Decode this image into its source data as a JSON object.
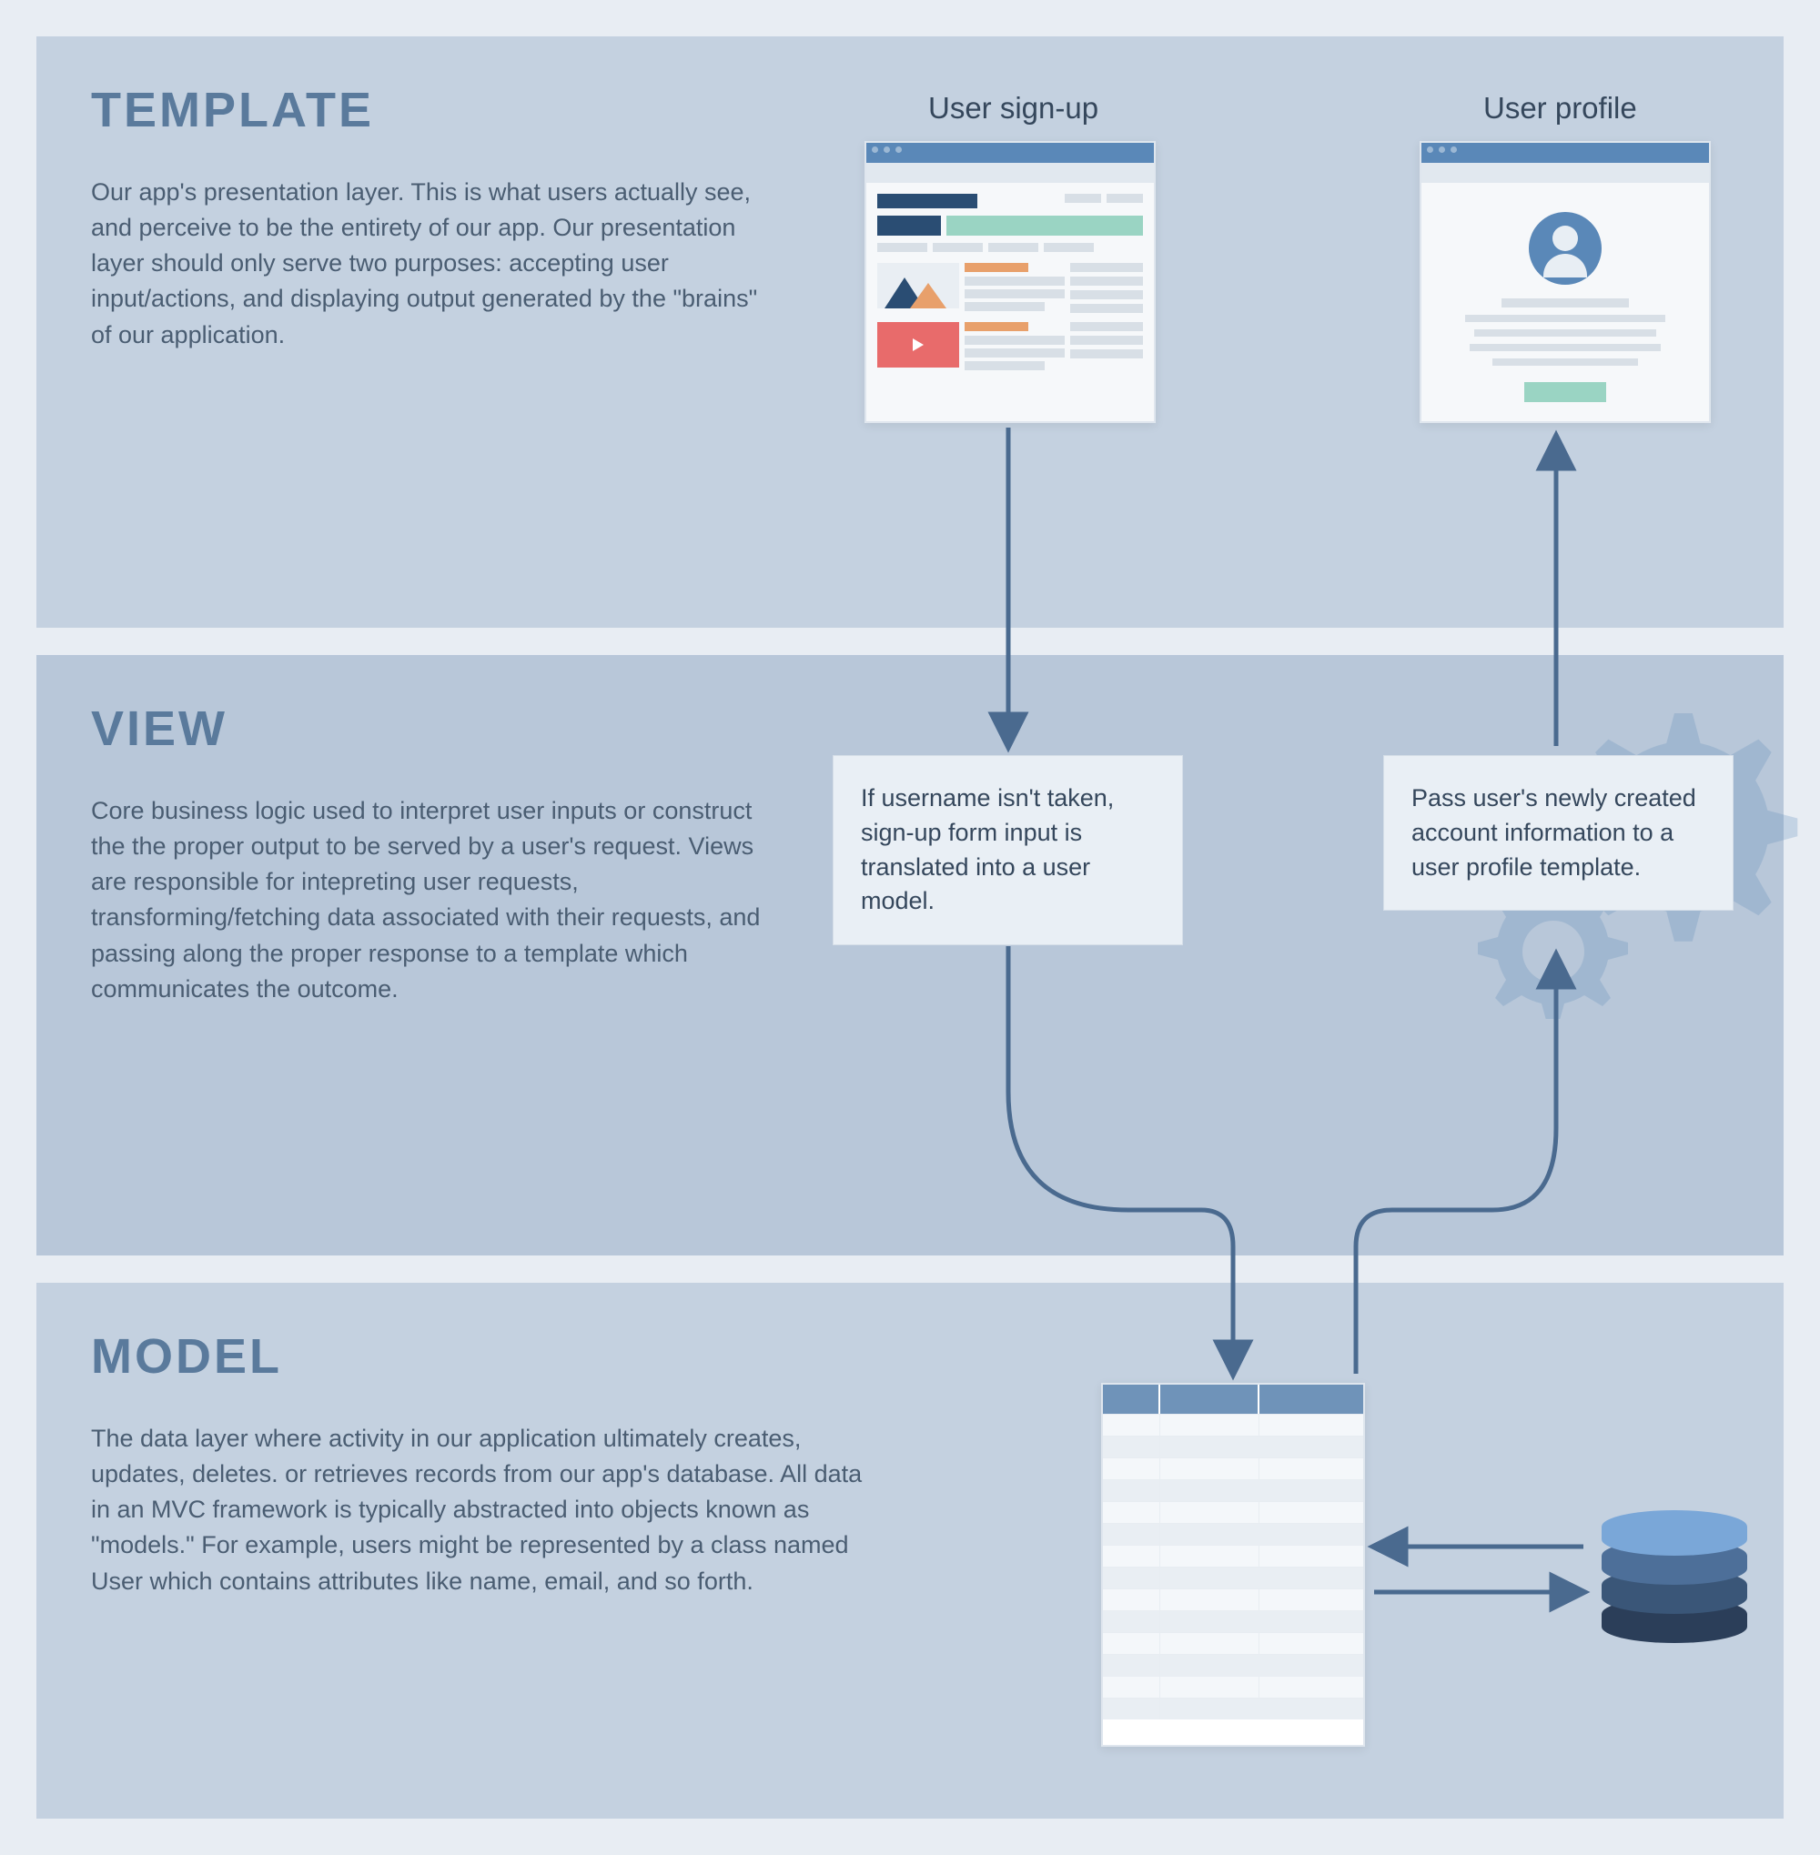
{
  "sections": {
    "template": {
      "title": "TEMPLATE",
      "body": "Our app's presentation layer. This is what users actually see, and perceive to be the entirety of our app. Our presentation layer should only serve two purposes: accepting user input/actions, and displaying output generated by the \"brains\" of our application."
    },
    "view": {
      "title": "VIEW",
      "body": "Core business logic used to interpret user inputs or construct the the proper output to be served by a user's request. Views are responsible for intepreting user requests, transforming/fetching data associated with their requests, and passing along the proper response to a template which communicates the outcome."
    },
    "model": {
      "title": "MODEL",
      "body": "The data layer where activity in our application ultimately creates, updates, deletes. or retrieves records from our app's database. All data in an MVC framework is typically abstracted into objects known as \"models.\" For example, users might be represented by a class named User which contains attributes like name, email, and so forth."
    }
  },
  "labels": {
    "signup": "User sign-up",
    "profile": "User profile"
  },
  "view_boxes": {
    "box1": "If username isn't taken, sign-up form input is translated into a user model.",
    "box2": "Pass user's newly created account information to a user profile template."
  }
}
